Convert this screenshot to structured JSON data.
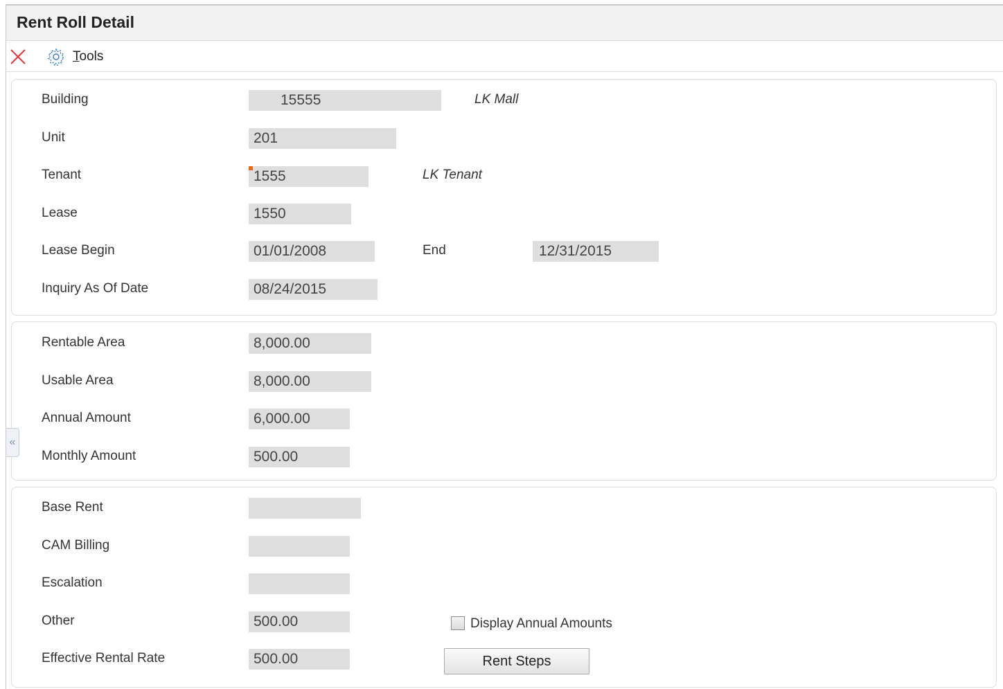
{
  "window": {
    "title": "Rent Roll Detail"
  },
  "toolbar": {
    "close_icon": "close-icon",
    "tools_label_u": "T",
    "tools_label_rest": "ools",
    "tools_icon": "gear-icon"
  },
  "header_fields": {
    "building_label": "Building",
    "building_value": "15555",
    "building_desc": "LK Mall",
    "unit_label": "Unit",
    "unit_value": "201",
    "tenant_label": "Tenant",
    "tenant_value": "1555",
    "tenant_desc": "LK Tenant",
    "lease_label": "Lease",
    "lease_value": "1550",
    "lease_begin_label": "Lease Begin",
    "lease_begin_value": "01/01/2008",
    "end_label": "End",
    "end_value": "12/31/2015",
    "inquiry_label": "Inquiry As Of Date",
    "inquiry_value": "08/24/2015"
  },
  "area_fields": {
    "rentable_label": "Rentable Area",
    "rentable_value": "8,000.00",
    "usable_label": "Usable Area",
    "usable_value": "8,000.00",
    "annual_label": "Annual Amount",
    "annual_value": "6,000.00",
    "monthly_label": "Monthly Amount",
    "monthly_value": "500.00"
  },
  "rent_fields": {
    "base_rent_label": "Base Rent",
    "base_rent_value": "",
    "cam_label": "CAM Billing",
    "cam_value": "",
    "escalation_label": "Escalation",
    "escalation_value": "",
    "other_label": "Other",
    "other_value": "500.00",
    "effective_label": "Effective Rental Rate",
    "effective_value": "500.00",
    "display_annual_label": "Display Annual Amounts",
    "display_annual_checked": false,
    "rent_steps_label": "Rent Steps"
  },
  "sidebar_toggle": {
    "glyph": "«"
  },
  "colors": {
    "field_bg": "#dedede",
    "close_red": "#e0393e",
    "tools_blue": "#2e7bd6",
    "required_orange": "#e8671b"
  }
}
